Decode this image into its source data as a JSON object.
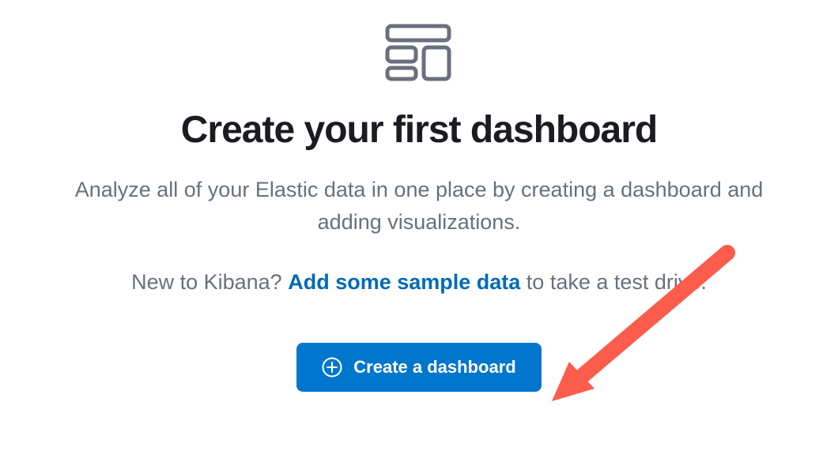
{
  "heading": "Create your first dashboard",
  "description": "Analyze all of your Elastic data in one place by creating a dashboard and adding visualizations.",
  "subtext": {
    "prefix": "New to Kibana? ",
    "link_text": "Add some sample data",
    "suffix": " to take a test drive."
  },
  "button": {
    "label": "Create a dashboard"
  },
  "colors": {
    "primary": "#0077cc",
    "text_dark": "#1a1c21",
    "text_muted": "#69707d",
    "link": "#006bb4",
    "annotation": "#fc5c4c"
  }
}
